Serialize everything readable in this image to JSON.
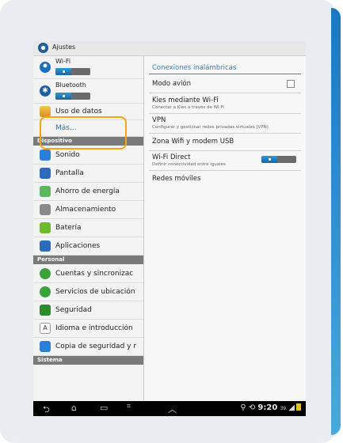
{
  "window": {
    "title": "Ajustes"
  },
  "left_panel": {
    "top_items": [
      {
        "label": "Wi-Fi"
      },
      {
        "label": "Bluetooth"
      },
      {
        "label": "Uso de datos"
      },
      {
        "label": "Más..."
      }
    ],
    "sections": [
      {
        "header": "Dispositivo",
        "items": [
          {
            "label": "Sonido",
            "icon": "sound-icon",
            "color": "#2b7fd6"
          },
          {
            "label": "Pantalla",
            "icon": "display-icon",
            "color": "#2b6cb8"
          },
          {
            "label": "Ahorro de energía",
            "icon": "battery-saver-icon",
            "color": "#5cb85c"
          },
          {
            "label": "Almacenamiento",
            "icon": "storage-icon",
            "color": "#8a8a8a"
          },
          {
            "label": "Batería",
            "icon": "battery-icon",
            "color": "#6bbd2b"
          },
          {
            "label": "Aplicaciones",
            "icon": "apps-icon",
            "color": "#2b6cb8"
          }
        ]
      },
      {
        "header": "Personal",
        "items": [
          {
            "label": "Cuentas y sincronizac",
            "icon": "sync-icon",
            "color": "#3aa33a"
          },
          {
            "label": "Servicios de ubicación",
            "icon": "location-icon",
            "color": "#3aa33a"
          },
          {
            "label": "Seguridad",
            "icon": "security-icon",
            "color": "#2a8c2a"
          },
          {
            "label": "Idioma e introducción",
            "icon": "language-icon",
            "color": "#ffffff"
          },
          {
            "label": "Copia de seguridad y r",
            "icon": "backup-icon",
            "color": "#2b7fd6"
          }
        ]
      },
      {
        "header": "Sistema",
        "items": []
      }
    ]
  },
  "right_panel": {
    "header": "Conexiones inalámbricas",
    "items": [
      {
        "title": "Modo avión",
        "subtitle": ""
      },
      {
        "title": "Kies mediante Wi-Fi",
        "subtitle": "Conectar a Kies a través de Wi-Fi"
      },
      {
        "title": "VPN",
        "subtitle": "Configurar y gestionar redes privadas virtuales (VPN)"
      },
      {
        "title": "Zona Wifi y modem USB",
        "subtitle": ""
      },
      {
        "title": "Wi-Fi Direct",
        "subtitle": "Definir conectividad entre iguales"
      },
      {
        "title": "Redes móviles",
        "subtitle": ""
      }
    ]
  },
  "status_bar": {
    "time": "9:20",
    "extra": "39"
  },
  "colors": {
    "accent": "#2f7fbf",
    "highlight": "#f2a516"
  }
}
